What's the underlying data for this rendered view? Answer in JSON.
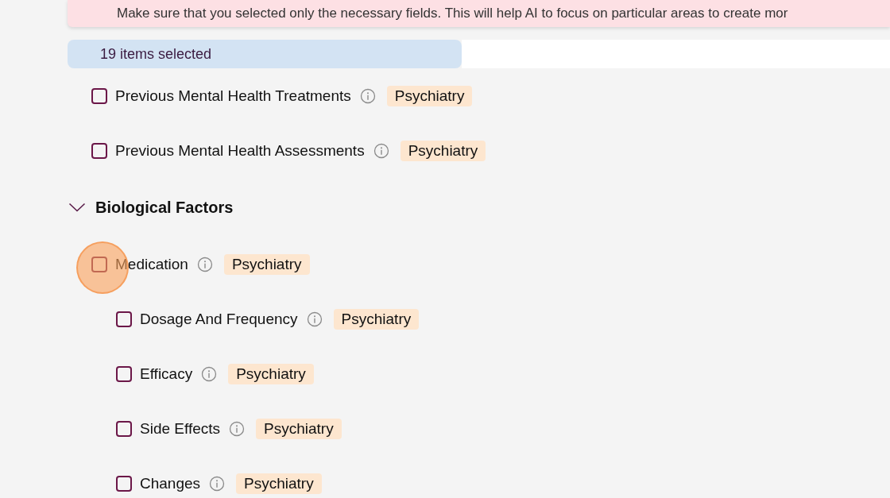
{
  "banner": {
    "text": "Make sure that you selected only the necessary fields. This will help AI to focus on particular areas to create mor"
  },
  "selection": {
    "text": "19 items selected"
  },
  "items": [
    {
      "label": "Previous Mental Health Treatments",
      "tag": "Psychiatry",
      "checked": false
    },
    {
      "label": "Previous Mental Health Assessments",
      "tag": "Psychiatry",
      "checked": false
    }
  ],
  "sections": [
    {
      "title": "Biological Factors",
      "expanded": true,
      "items": [
        {
          "label": "Medication",
          "tag": "Psychiatry",
          "checked": false,
          "clicked": true,
          "children": [
            {
              "label": "Dosage And Frequency",
              "tag": "Psychiatry",
              "checked": false
            },
            {
              "label": "Efficacy",
              "tag": "Psychiatry",
              "checked": false
            },
            {
              "label": "Side Effects",
              "tag": "Psychiatry",
              "checked": false
            },
            {
              "label": "Changes",
              "tag": "Psychiatry",
              "checked": false
            }
          ]
        }
      ]
    }
  ]
}
